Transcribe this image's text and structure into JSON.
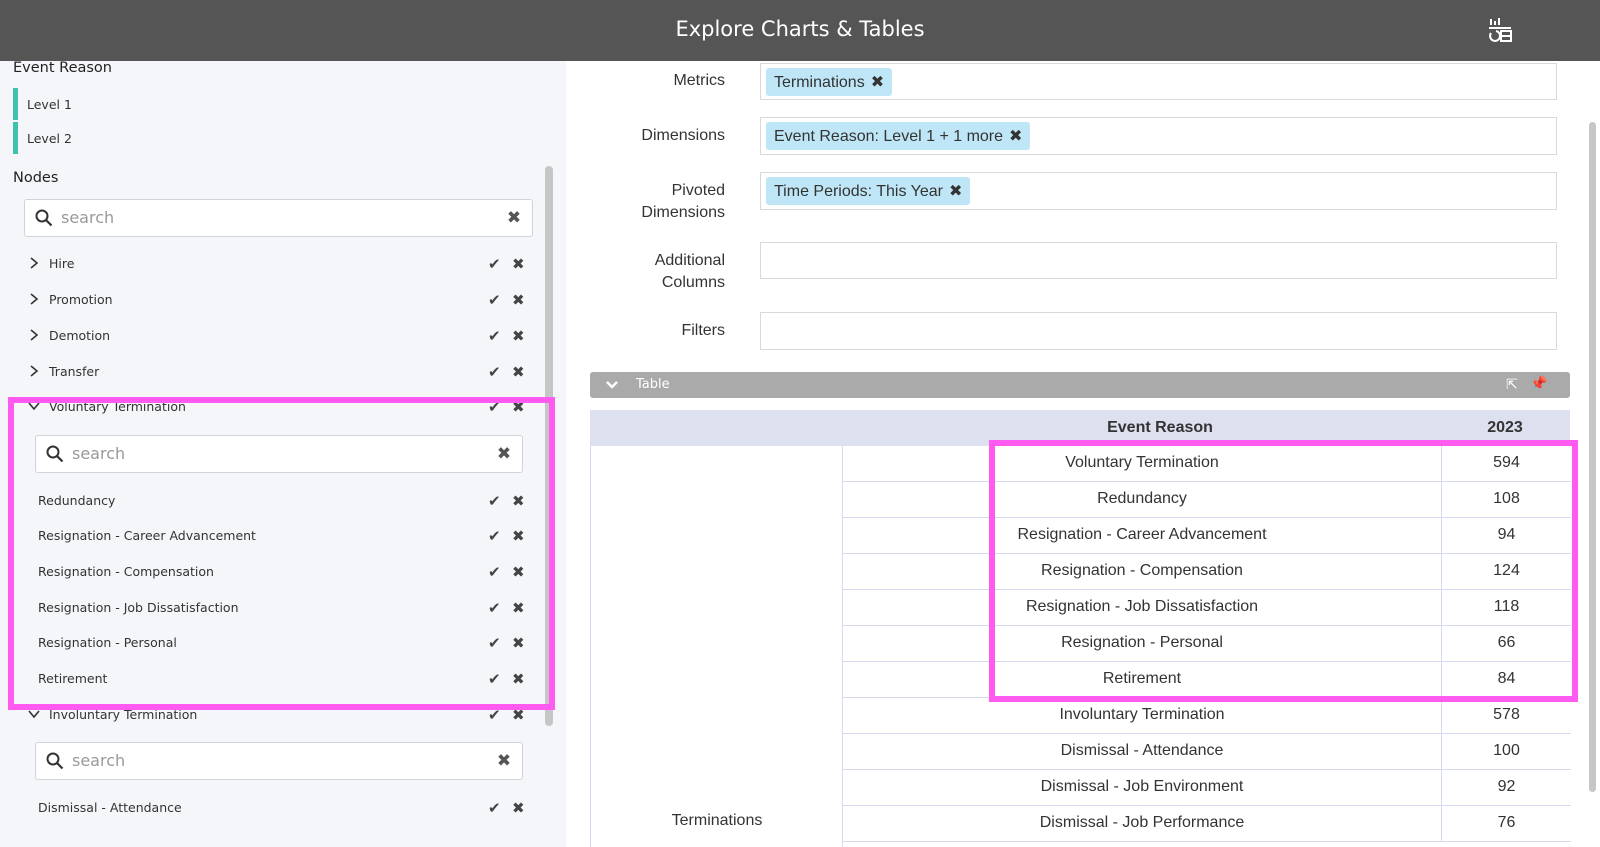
{
  "header": {
    "title": "Explore Charts & Tables",
    "icon": "chart-table-icon"
  },
  "sidebar": {
    "event_reason_label": "Event Reason",
    "levels": [
      "Level 1",
      "Level 2"
    ],
    "nodes_label": "Nodes",
    "search_placeholder": "search",
    "collapsed_nodes": [
      "Hire",
      "Promotion",
      "Demotion",
      "Transfer"
    ],
    "voluntary": {
      "label": "Voluntary Termination",
      "search_placeholder": "search",
      "children": [
        "Redundancy",
        "Resignation - Career Advancement",
        "Resignation - Compensation",
        "Resignation - Job Dissatisfaction",
        "Resignation - Personal",
        "Retirement"
      ]
    },
    "involuntary": {
      "label": "Involuntary Termination",
      "search_placeholder": "search",
      "children": [
        "Dismissal - Attendance"
      ]
    }
  },
  "form": {
    "metrics": {
      "label": "Metrics",
      "chip": "Terminations"
    },
    "dimensions": {
      "label": "Dimensions",
      "chip": "Event Reason: Level 1 + 1 more"
    },
    "pivoted": {
      "label_line1": "Pivoted",
      "label_line2": "Dimensions",
      "chip": "Time Periods: This Year"
    },
    "additional": {
      "label_line1": "Additional",
      "label_line2": "Columns"
    },
    "filters": {
      "label": "Filters"
    }
  },
  "table": {
    "bar_title": "Table",
    "col_header_reason": "Event Reason",
    "col_header_year": "2023",
    "metric_label": "Terminations",
    "rows": [
      {
        "reason": "Voluntary Termination",
        "value": "594"
      },
      {
        "reason": "Redundancy",
        "value": "108"
      },
      {
        "reason": "Resignation - Career Advancement",
        "value": "94"
      },
      {
        "reason": "Resignation - Compensation",
        "value": "124"
      },
      {
        "reason": "Resignation - Job Dissatisfaction",
        "value": "118"
      },
      {
        "reason": "Resignation - Personal",
        "value": "66"
      },
      {
        "reason": "Retirement",
        "value": "84"
      },
      {
        "reason": "Involuntary Termination",
        "value": "578"
      },
      {
        "reason": "Dismissal - Attendance",
        "value": "100"
      },
      {
        "reason": "Dismissal - Job Environment",
        "value": "92"
      },
      {
        "reason": "Dismissal - Job Performance",
        "value": "76"
      }
    ]
  },
  "colors": {
    "highlight": "#ff5bf0",
    "chip": "#bfe6f7",
    "level_bar": "#3fc1b0",
    "header_bg": "#555555"
  }
}
